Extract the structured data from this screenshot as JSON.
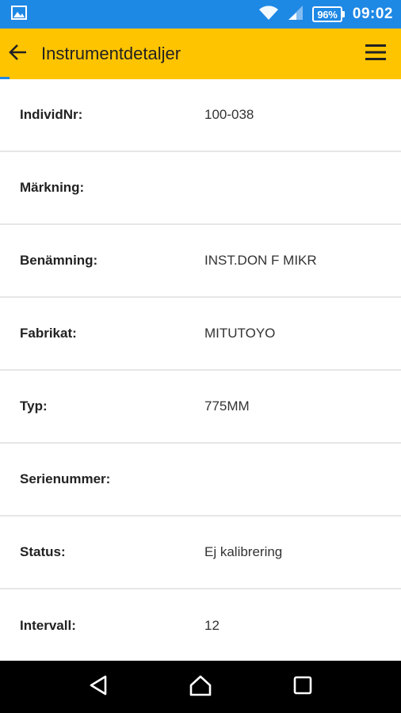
{
  "status_bar": {
    "battery": "96%",
    "time": "09:02",
    "icons": [
      "gallery-icon",
      "wifi-icon",
      "signal-icon",
      "battery-icon"
    ]
  },
  "app_bar": {
    "title": "Instrumentdetaljer",
    "back_icon": "arrow-left-icon",
    "menu_icon": "hamburger-menu-icon",
    "color": "#ffc400"
  },
  "details": [
    {
      "label": "IndividNr:",
      "value": "100-038"
    },
    {
      "label": "Märkning:",
      "value": ""
    },
    {
      "label": "Benämning:",
      "value": "INST.DON F MIKR"
    },
    {
      "label": "Fabrikat:",
      "value": "MITUTOYO"
    },
    {
      "label": "Typ:",
      "value": "775MM"
    },
    {
      "label": "Serienummer:",
      "value": ""
    },
    {
      "label": "Status:",
      "value": "Ej kalibrering"
    },
    {
      "label": "Intervall:",
      "value": "12"
    }
  ],
  "nav_bar": {
    "icons": [
      "back-triangle-icon",
      "home-icon",
      "recents-square-icon"
    ]
  },
  "colors": {
    "status_bar": "#1e88e5",
    "app_bar": "#ffc400",
    "divider": "#e6e6e6"
  }
}
